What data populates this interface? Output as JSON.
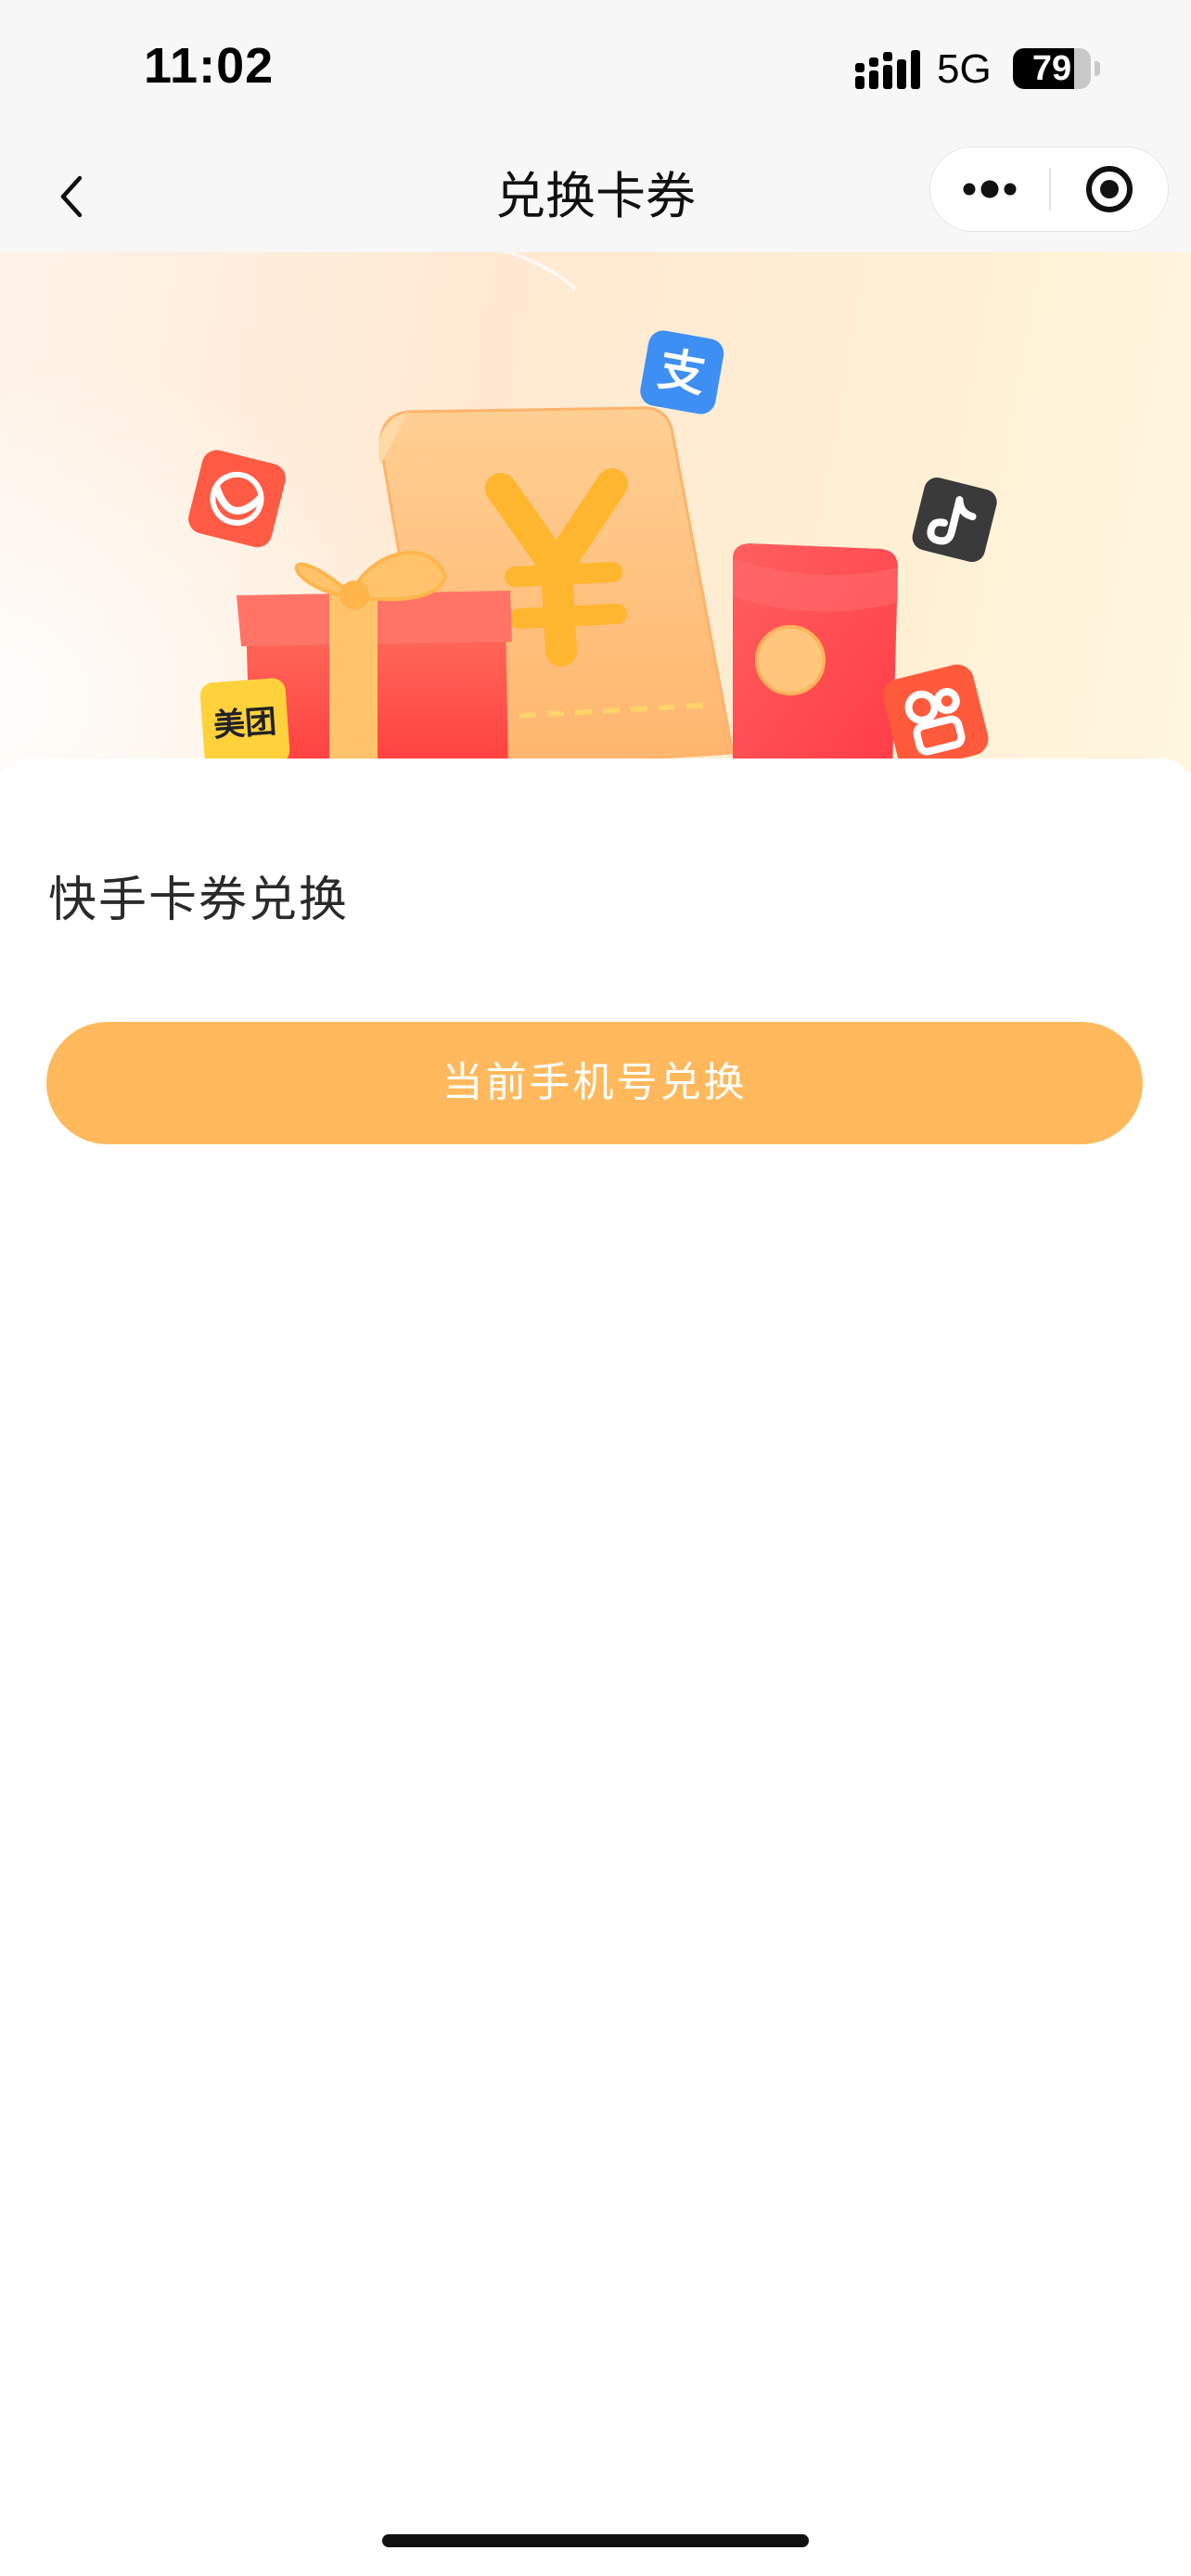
{
  "status_bar": {
    "time": "11:02",
    "network": "5G",
    "battery_level": "79",
    "battery_fraction": 0.79
  },
  "nav": {
    "title": "兑换卡券",
    "back_icon": "chevron-left-icon",
    "more_icon": "more-dots-icon",
    "close_icon": "target-circle-icon"
  },
  "banner": {
    "currency_symbol": "¥",
    "brand_badges": {
      "alipay": "支",
      "meituan": "美团"
    },
    "colors": {
      "gift": "#ff5a4d",
      "ribbon": "#ffc46b",
      "receipt": "#ffc07a",
      "red_packet": "#ff4d4d"
    }
  },
  "content": {
    "section_title": "快手卡券兑换",
    "redeem_button_label": "当前手机号兑换",
    "accent_color": "#ffb95c"
  }
}
